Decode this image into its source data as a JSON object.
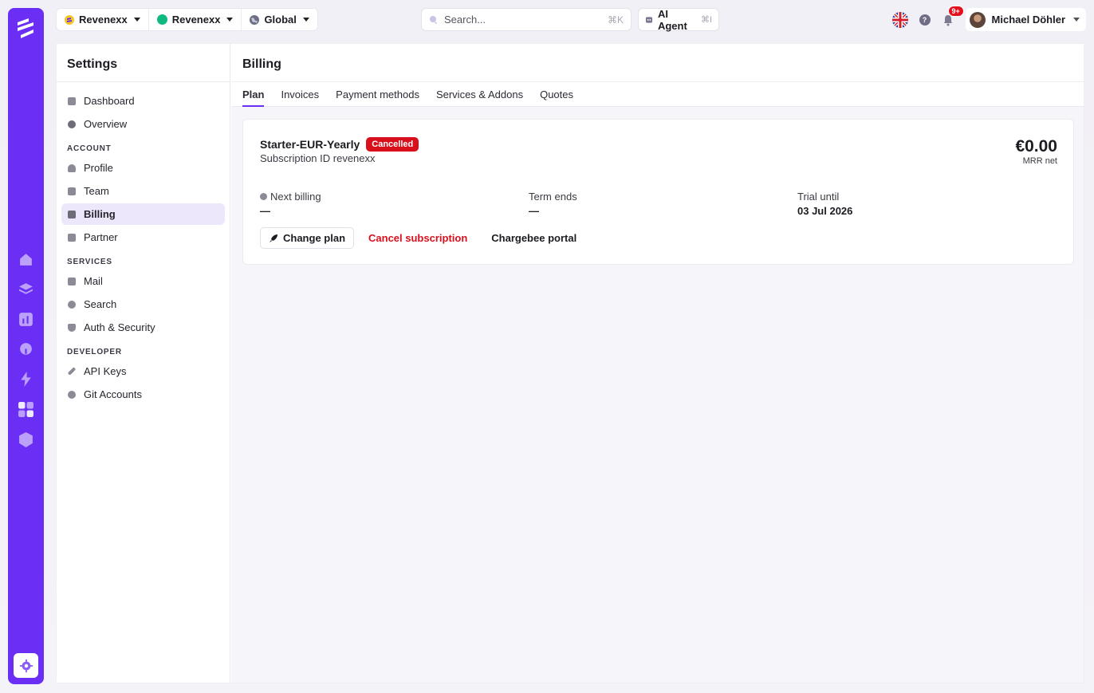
{
  "colors": {
    "accent": "#6a2ef5",
    "danger": "#d9101c",
    "org_dot": "#10b981"
  },
  "rail": {
    "icons": [
      "home-icon",
      "layers-icon",
      "chart-icon",
      "pin-icon",
      "bolt-icon",
      "grid-icon",
      "box-icon",
      "gear-icon"
    ]
  },
  "topbar": {
    "switchers": [
      {
        "label": "Revenexx",
        "icon": "revenexx-logo-icon"
      },
      {
        "label": "Revenexx",
        "icon": "green-dot-icon"
      },
      {
        "label": "Global",
        "icon": "globe-icon"
      }
    ],
    "search": {
      "placeholder": "Search...",
      "shortcut": "⌘K"
    },
    "agent": {
      "label": "AI Agent",
      "shortcut": "⌘I"
    },
    "notifications_badge": "9+",
    "help_label": "?",
    "user_name": "Michael Döhler"
  },
  "sidebar": {
    "title": "Settings",
    "top_items": [
      {
        "label": "Dashboard",
        "icon": "dashboard-icon"
      },
      {
        "label": "Overview",
        "icon": "overview-icon"
      }
    ],
    "sections": [
      {
        "title": "ACCOUNT",
        "items": [
          {
            "label": "Profile",
            "icon": "user-icon"
          },
          {
            "label": "Team",
            "icon": "team-icon"
          },
          {
            "label": "Billing",
            "icon": "card-icon",
            "active": true
          },
          {
            "label": "Partner",
            "icon": "store-icon"
          }
        ]
      },
      {
        "title": "SERVICES",
        "items": [
          {
            "label": "Mail",
            "icon": "mail-icon"
          },
          {
            "label": "Search",
            "icon": "search-icon"
          },
          {
            "label": "Auth & Security",
            "icon": "shield-icon"
          }
        ]
      },
      {
        "title": "DEVELOPER",
        "items": [
          {
            "label": "API Keys",
            "icon": "key-icon"
          },
          {
            "label": "Git Accounts",
            "icon": "git-icon"
          }
        ]
      }
    ]
  },
  "content": {
    "title": "Billing",
    "tabs": [
      "Plan",
      "Invoices",
      "Payment methods",
      "Services & Addons",
      "Quotes"
    ],
    "active_tab": "Plan",
    "plan": {
      "name": "Starter-EUR-Yearly",
      "status": "Cancelled",
      "subscription_id": "Subscription ID revenexx",
      "price": "€0.00",
      "price_label": "MRR net",
      "next_billing_label": "Next billing",
      "next_billing_value": "—",
      "term_ends_label": "Term ends",
      "term_ends_value": "—",
      "trial_until_label": "Trial until",
      "trial_until_value": "03 Jul 2026",
      "change_plan": "Change plan",
      "cancel_subscription": "Cancel subscription",
      "portal": "Chargebee portal"
    }
  }
}
